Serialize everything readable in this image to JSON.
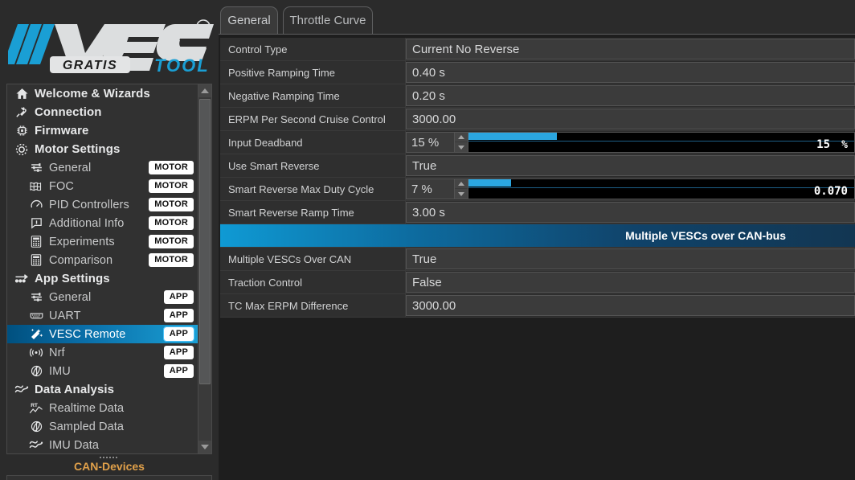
{
  "logo": {
    "brand": "VESC",
    "sub": "GRATIS",
    "tool": "TOOL",
    "registered": "®",
    "accent_color": "#1a9fd4"
  },
  "sidebar": {
    "items": [
      {
        "label": "Welcome & Wizards",
        "icon": "home-icon",
        "level": "group",
        "badge": "",
        "selected": false
      },
      {
        "label": "Connection",
        "icon": "plug-icon",
        "level": "group",
        "badge": "",
        "selected": false
      },
      {
        "label": "Firmware",
        "icon": "chip-icon",
        "level": "group",
        "badge": "",
        "selected": false
      },
      {
        "label": "Motor Settings",
        "icon": "gear-ring-icon",
        "level": "group",
        "badge": "",
        "selected": false
      },
      {
        "label": "General",
        "icon": "sliders-icon",
        "level": "sub",
        "badge": "MOTOR",
        "selected": false
      },
      {
        "label": "FOC",
        "icon": "waves-icon",
        "level": "sub",
        "badge": "MOTOR",
        "selected": false
      },
      {
        "label": "PID Controllers",
        "icon": "gauge-icon",
        "level": "sub",
        "badge": "MOTOR",
        "selected": false
      },
      {
        "label": "Additional Info",
        "icon": "info-bubble-icon",
        "level": "sub",
        "badge": "MOTOR",
        "selected": false
      },
      {
        "label": "Experiments",
        "icon": "calculator-icon",
        "level": "sub",
        "badge": "MOTOR",
        "selected": false
      },
      {
        "label": "Comparison",
        "icon": "calculator-icon",
        "level": "sub",
        "badge": "MOTOR",
        "selected": false
      },
      {
        "label": "App Settings",
        "icon": "arrows-icon",
        "level": "group",
        "badge": "",
        "selected": false
      },
      {
        "label": "General",
        "icon": "sliders-icon",
        "level": "sub",
        "badge": "APP",
        "selected": false
      },
      {
        "label": "UART",
        "icon": "connector-icon",
        "level": "sub",
        "badge": "APP",
        "selected": false
      },
      {
        "label": "VESC Remote",
        "icon": "wand-icon",
        "level": "sub",
        "badge": "APP",
        "selected": true
      },
      {
        "label": "Nrf",
        "icon": "antenna-icon",
        "level": "sub",
        "badge": "APP",
        "selected": false
      },
      {
        "label": "IMU",
        "icon": "imu-icon",
        "level": "sub",
        "badge": "APP",
        "selected": false
      },
      {
        "label": "Data Analysis",
        "icon": "zigzag-icon",
        "level": "group",
        "badge": "",
        "selected": false
      },
      {
        "label": "Realtime Data",
        "icon": "rt-chart-icon",
        "level": "sub",
        "badge": "",
        "selected": false
      },
      {
        "label": "Sampled Data",
        "icon": "imu-icon",
        "level": "sub",
        "badge": "",
        "selected": false
      },
      {
        "label": "IMU Data",
        "icon": "zigzag-icon",
        "level": "sub",
        "badge": "",
        "selected": false
      }
    ],
    "can_devices_title": "CAN-Devices",
    "selected_color": "#1a9fd4"
  },
  "tabs": [
    {
      "label": "General",
      "active": true
    },
    {
      "label": "Throttle Curve",
      "active": false
    }
  ],
  "settings": {
    "rows": [
      {
        "name": "Control Type",
        "value": "Current No Reverse",
        "type": "field"
      },
      {
        "name": "Positive Ramping Time",
        "value": "0.40 s",
        "type": "field"
      },
      {
        "name": "Negative Ramping Time",
        "value": "0.20 s",
        "type": "field"
      },
      {
        "name": "ERPM Per Second Cruise Control",
        "value": "3000.00",
        "type": "field"
      },
      {
        "name": "Input Deadband",
        "value": "15 %",
        "type": "spin",
        "bar_percent": 23,
        "bar_text": "15",
        "bar_unit": "%"
      },
      {
        "name": "Use Smart Reverse",
        "value": "True",
        "type": "field"
      },
      {
        "name": "Smart Reverse Max Duty Cycle",
        "value": "7 %",
        "type": "spin",
        "bar_percent": 11,
        "bar_text": "0.070",
        "bar_unit": ""
      },
      {
        "name": "Smart Reverse Ramp Time",
        "value": "3.00 s",
        "type": "field"
      },
      {
        "name": "Multiple VESCs over CAN-bus",
        "value": "",
        "type": "header"
      },
      {
        "name": "Multiple VESCs Over CAN",
        "value": "True",
        "type": "field"
      },
      {
        "name": "Traction Control",
        "value": "False",
        "type": "field"
      },
      {
        "name": "TC Max ERPM Difference",
        "value": "3000.00",
        "type": "field"
      }
    ]
  }
}
